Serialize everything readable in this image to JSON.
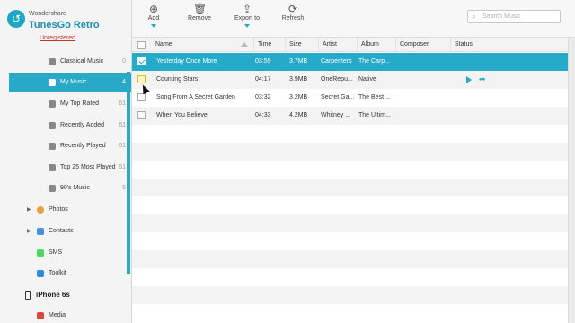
{
  "app": {
    "brand": "Wondershare",
    "product": "TunesGo Retro",
    "unregistered": "Unregistered",
    "accent": "#27a9c7"
  },
  "sidebar": {
    "playlists": [
      {
        "label": "Classical Music",
        "count": "0",
        "icon": "playlist-gear-icon"
      },
      {
        "label": "My Music",
        "count": "4",
        "icon": "playlist-gear-icon",
        "active": true
      },
      {
        "label": "My Top Rated",
        "count": "61",
        "icon": "playlist-gear-icon"
      },
      {
        "label": "Recently Added",
        "count": "61",
        "icon": "playlist-gear-icon"
      },
      {
        "label": "Recently Played",
        "count": "61",
        "icon": "playlist-gear-icon"
      },
      {
        "label": "Top 25 Most Played",
        "count": "61",
        "icon": "playlist-gear-icon"
      },
      {
        "label": "90's Music",
        "count": "5",
        "icon": "playlist-gear-icon"
      }
    ],
    "categories": [
      {
        "label": "Photos",
        "icon": "photos-icon",
        "color": "#e6a23c"
      },
      {
        "label": "Contacts",
        "icon": "contacts-icon",
        "color": "#4a90e2"
      },
      {
        "label": "SMS",
        "icon": "sms-icon",
        "color": "#4cd964"
      },
      {
        "label": "Toolkit",
        "icon": "toolkit-icon",
        "color": "#2d8ee0"
      }
    ],
    "device": "iPhone 6s",
    "device_media": "Media"
  },
  "toolbar": {
    "add": "Add",
    "remove": "Remove",
    "export": "Export to",
    "refresh": "Refresh",
    "search_placeholder": "Search Music"
  },
  "table": {
    "headers": {
      "name": "Name",
      "time": "Time",
      "size": "Size",
      "artist": "Artist",
      "album": "Album",
      "composer": "Composer",
      "status": "Status"
    },
    "rows": [
      {
        "name": "Yesterday Once More",
        "time": "03:59",
        "size": "3.7MB",
        "artist": "Carpenters",
        "album": "The Carp..."
      },
      {
        "name": "Counting Stars",
        "time": "04:17",
        "size": "3.9MB",
        "artist": "OneRepu...",
        "album": "Native"
      },
      {
        "name": "Song From A Secret Garden",
        "time": "03:32",
        "size": "3.2MB",
        "artist": "Secret Ga...",
        "album": "The Best ..."
      },
      {
        "name": "When You Believe",
        "time": "04:33",
        "size": "4.2MB",
        "artist": "Whitney ...",
        "album": "The Ultim..."
      }
    ]
  }
}
